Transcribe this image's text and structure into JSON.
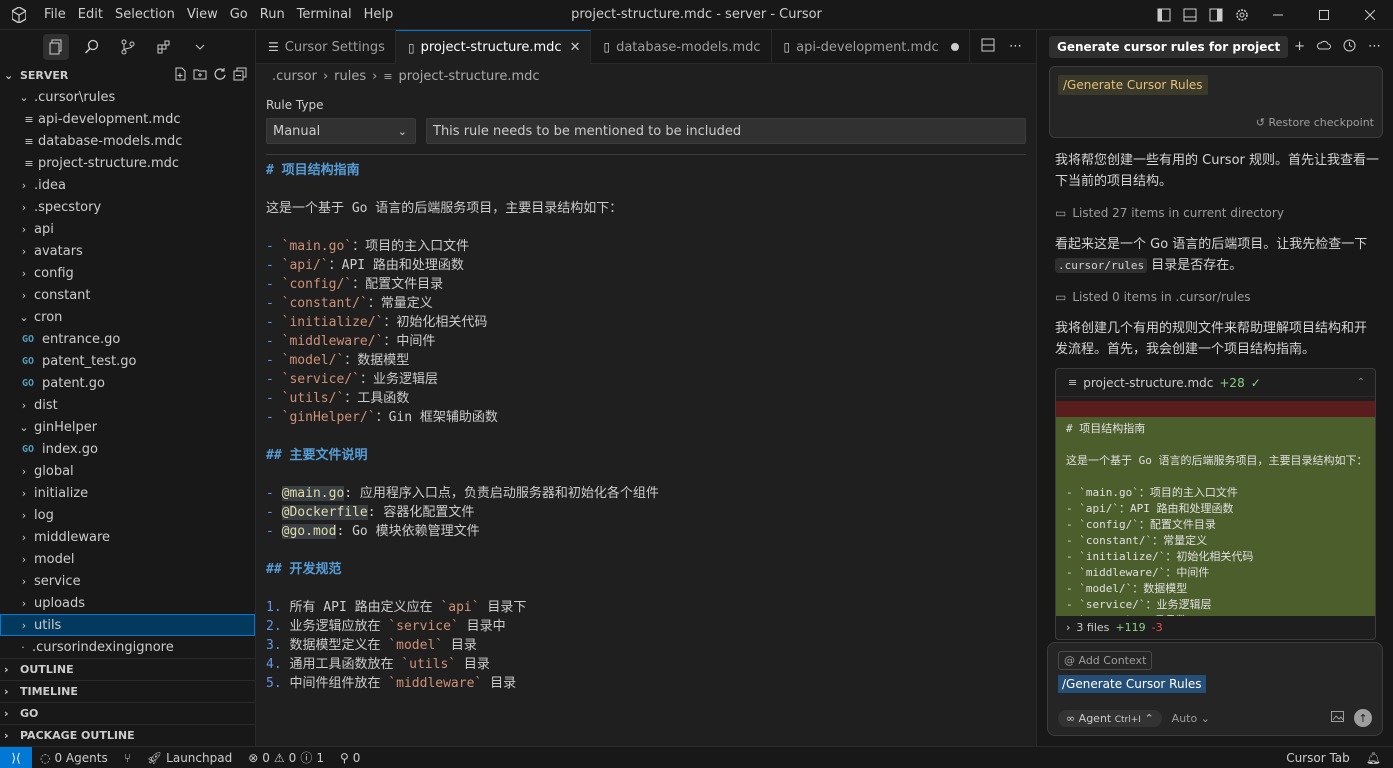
{
  "titlebar": {
    "menu": [
      "File",
      "Edit",
      "Selection",
      "View",
      "Go",
      "Run",
      "Terminal",
      "Help"
    ],
    "title": "project-structure.mdc - server - Cursor"
  },
  "sidebar": {
    "header": "SERVER",
    "tree": [
      {
        "label": ".cursor\\rules",
        "kind": "folder-open",
        "depth": 1
      },
      {
        "label": "api-development.mdc",
        "kind": "file",
        "depth": 2
      },
      {
        "label": "database-models.mdc",
        "kind": "file",
        "depth": 2
      },
      {
        "label": "project-structure.mdc",
        "kind": "file",
        "depth": 2
      },
      {
        "label": ".idea",
        "kind": "folder",
        "depth": 1
      },
      {
        "label": ".specstory",
        "kind": "folder",
        "depth": 1
      },
      {
        "label": "api",
        "kind": "folder",
        "depth": 1
      },
      {
        "label": "avatars",
        "kind": "folder",
        "depth": 1
      },
      {
        "label": "config",
        "kind": "folder",
        "depth": 1
      },
      {
        "label": "constant",
        "kind": "folder",
        "depth": 1
      },
      {
        "label": "cron",
        "kind": "folder-open",
        "depth": 1
      },
      {
        "label": "entrance.go",
        "kind": "go",
        "depth": 2
      },
      {
        "label": "patent_test.go",
        "kind": "go",
        "depth": 2
      },
      {
        "label": "patent.go",
        "kind": "go",
        "depth": 2
      },
      {
        "label": "dist",
        "kind": "folder",
        "depth": 1
      },
      {
        "label": "ginHelper",
        "kind": "folder-open",
        "depth": 1
      },
      {
        "label": "index.go",
        "kind": "go",
        "depth": 2
      },
      {
        "label": "global",
        "kind": "folder",
        "depth": 1
      },
      {
        "label": "initialize",
        "kind": "folder",
        "depth": 1
      },
      {
        "label": "log",
        "kind": "folder",
        "depth": 1
      },
      {
        "label": "middleware",
        "kind": "folder",
        "depth": 1
      },
      {
        "label": "model",
        "kind": "folder",
        "depth": 1
      },
      {
        "label": "service",
        "kind": "folder",
        "depth": 1
      },
      {
        "label": "uploads",
        "kind": "folder",
        "depth": 1
      },
      {
        "label": "utils",
        "kind": "folder",
        "depth": 1,
        "selected": true
      },
      {
        "label": ".cursorindexingignore",
        "kind": "file",
        "depth": 1
      }
    ],
    "sections": [
      "OUTLINE",
      "TIMELINE",
      "GO",
      "PACKAGE OUTLINE"
    ]
  },
  "editor": {
    "tabs": [
      {
        "label": "Cursor Settings",
        "active": false
      },
      {
        "label": "project-structure.mdc",
        "active": true
      },
      {
        "label": "database-models.mdc",
        "active": false
      },
      {
        "label": "api-development.mdc",
        "active": false,
        "dirty": true
      }
    ],
    "breadcrumb": [
      ".cursor",
      "rules",
      "project-structure.mdc"
    ],
    "rule_type_label": "Rule Type",
    "rule_type_value": "Manual",
    "rule_description": "This rule needs to be mentioned to be included",
    "code_lines": [
      {
        "type": "h",
        "text": "# 项目结构指南"
      },
      {
        "type": "blank"
      },
      {
        "type": "text",
        "text": "这是一个基于 Go 语言的后端服务项目，主要目录结构如下："
      },
      {
        "type": "blank"
      },
      {
        "type": "item",
        "code": "main.go",
        "rest": "：项目的主入口文件"
      },
      {
        "type": "item",
        "code": "api/",
        "rest": "：API 路由和处理函数"
      },
      {
        "type": "item",
        "code": "config/",
        "rest": "：配置文件目录"
      },
      {
        "type": "item",
        "code": "constant/",
        "rest": "：常量定义"
      },
      {
        "type": "item",
        "code": "initialize/",
        "rest": "：初始化相关代码"
      },
      {
        "type": "item",
        "code": "middleware/",
        "rest": "：中间件"
      },
      {
        "type": "item",
        "code": "model/",
        "rest": "：数据模型"
      },
      {
        "type": "item",
        "code": "service/",
        "rest": "：业务逻辑层"
      },
      {
        "type": "item",
        "code": "utils/",
        "rest": "：工具函数"
      },
      {
        "type": "item",
        "code": "ginHelper/",
        "rest": "：Gin 框架辅助函数"
      },
      {
        "type": "blank"
      },
      {
        "type": "h",
        "text": "## 主要文件说明"
      },
      {
        "type": "blank"
      },
      {
        "type": "ref",
        "ref": "@main.go",
        "rest": ": 应用程序入口点，负责启动服务器和初始化各个组件"
      },
      {
        "type": "ref",
        "ref": "@Dockerfile",
        "rest": ": 容器化配置文件"
      },
      {
        "type": "ref",
        "ref": "@go.mod",
        "rest": ": Go 模块依赖管理文件"
      },
      {
        "type": "blank"
      },
      {
        "type": "h",
        "text": "## 开发规范"
      },
      {
        "type": "blank"
      },
      {
        "type": "num",
        "n": "1.",
        "pre": " 所有 API 路由定义应在 ",
        "code": "api",
        "post": " 目录下"
      },
      {
        "type": "num",
        "n": "2.",
        "pre": " 业务逻辑应放在 ",
        "code": "service",
        "post": " 目录中"
      },
      {
        "type": "num",
        "n": "3.",
        "pre": " 数据模型定义在 ",
        "code": "model",
        "post": " 目录"
      },
      {
        "type": "num",
        "n": "4.",
        "pre": " 通用工具函数放在 ",
        "code": "utils",
        "post": " 目录"
      },
      {
        "type": "num",
        "n": "5.",
        "pre": " 中间件组件放在 ",
        "code": "middleware",
        "post": " 目录"
      }
    ]
  },
  "chat": {
    "header_chip": "Generate cursor rules for project",
    "user_command": "/Generate Cursor Rules",
    "restore": "Restore checkpoint",
    "p1": "我将帮您创建一些有用的 Cursor 规则。首先让我查看一下当前的项目结构。",
    "tool1": "Listed 27 items in current directory",
    "p2a": "看起来这是一个 Go 语言的后端项目。让我先检查一下",
    "p2code": ".cursor/rules",
    "p2b": "目录是否存在。",
    "tool2": "Listed 0 items in .cursor/rules",
    "p3": "我将创建几个有用的规则文件来帮助理解项目结构和开发流程。首先，我会创建一个项目结构指南。",
    "diff_file": "project-structure.mdc",
    "diff_count": "+28",
    "diff_lines": [
      "# 项目结构指南",
      "",
      "这是一个基于 Go 语言的后端服务项目，主要目录结构如下：",
      "",
      "- `main.go`：项目的主入口文件",
      "- `api/`：API 路由和处理函数",
      "- `config/`：配置文件目录",
      "- `constant/`：常量定义",
      "- `initialize/`：初始化相关代码",
      "- `middleware/`：中间件",
      "- `model/`：数据模型",
      "- `service/`：业务逻辑层",
      "- `utils/`：工具函数"
    ],
    "files_summary": "3 files",
    "files_add": "+119",
    "files_del": "-3",
    "add_context": "@ Add Context",
    "composer_text": "/Generate Cursor Rules",
    "agent_label": "Agent",
    "agent_shortcut": "Ctrl+I",
    "model_label": "Auto"
  },
  "statusbar": {
    "agents": "0 Agents",
    "launchpad": "Launchpad",
    "problems_err": "0",
    "problems_warn": "0",
    "problems_info": "1",
    "ports": "0",
    "cursor_tab": "Cursor Tab"
  }
}
